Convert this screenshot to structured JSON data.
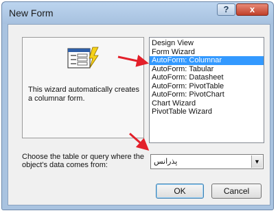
{
  "window": {
    "title": "New Form",
    "help_label": "?",
    "close_label": "x"
  },
  "preview": {
    "description": "This wizard automatically creates a columnar form."
  },
  "form_types": {
    "items": [
      "Design View",
      "Form Wizard",
      "AutoForm: Columnar",
      "AutoForm: Tabular",
      "AutoForm: Datasheet",
      "AutoForm: PivotTable",
      "AutoForm: PivotChart",
      "Chart Wizard",
      "PivotTable Wizard"
    ],
    "selected": "AutoForm: Columnar"
  },
  "source": {
    "label": "Choose the table or query where the object's data comes from:",
    "value": "پذرانس",
    "arrow": "▼"
  },
  "buttons": {
    "ok": "OK",
    "cancel": "Cancel"
  },
  "colors": {
    "selection": "#3399ff",
    "annotation_arrow": "#e3202a"
  },
  "icons": [
    "form-wizard-icon",
    "chevron-down-icon",
    "help-icon",
    "close-icon"
  ]
}
